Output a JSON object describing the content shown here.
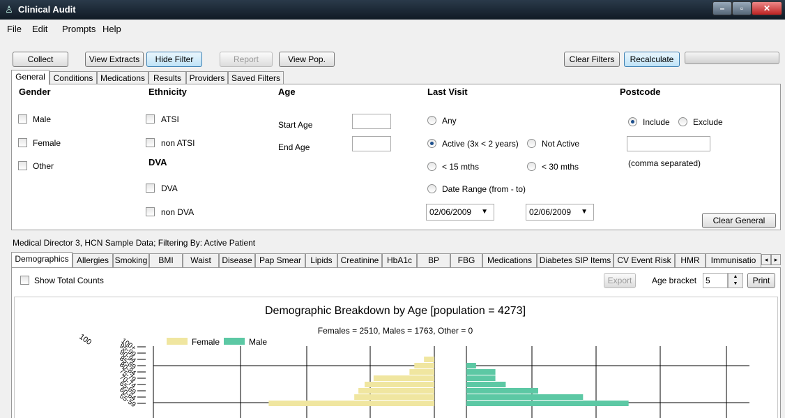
{
  "window": {
    "title": "Clinical Audit"
  },
  "menu": [
    "File",
    "Edit",
    "Prompts",
    "Help"
  ],
  "toolbar": {
    "collect": "Collect",
    "view_extracts": "View Extracts",
    "hide_filter": "Hide Filter",
    "report": "Report",
    "view_pop": "View Pop.",
    "clear_filters": "Clear Filters",
    "recalculate": "Recalculate"
  },
  "filter_tabs": [
    "General",
    "Conditions",
    "Medications",
    "Results",
    "Providers",
    "Saved Filters"
  ],
  "general": {
    "gender": {
      "header": "Gender",
      "options": [
        "Male",
        "Female",
        "Other"
      ]
    },
    "ethnicity": {
      "header": "Ethnicity",
      "options": [
        "ATSI",
        "non ATSI"
      ]
    },
    "dva": {
      "header": "DVA",
      "options": [
        "DVA",
        "non DVA"
      ]
    },
    "age": {
      "header": "Age",
      "start_label": "Start Age",
      "end_label": "End Age",
      "start_value": "",
      "end_value": ""
    },
    "last_visit": {
      "header": "Last Visit",
      "any": "Any",
      "active": "Active (3x < 2 years)",
      "not_active": "Not Active",
      "lt15": "< 15 mths",
      "lt30": "< 30 mths",
      "date_range": "Date Range (from - to)",
      "selected": "active",
      "date_from": "02/06/2009",
      "date_to": "02/06/2009"
    },
    "postcode": {
      "header": "Postcode",
      "include": "Include",
      "exclude": "Exclude",
      "selected": "include",
      "value": "",
      "hint": "(comma separated)"
    },
    "clear_general": "Clear General"
  },
  "status_text": "Medical Director 3, HCN Sample Data; Filtering By: Active Patient",
  "result_tabs": [
    "Demographics",
    "Allergies",
    "Smoking",
    "BMI",
    "Waist",
    "Disease",
    "Pap Smear",
    "Lipids",
    "Creatinine",
    "HbA1c",
    "BP",
    "FBG",
    "Medications",
    "Diabetes SIP Items",
    "CV Event Risk",
    "HMR",
    "Immunisatio"
  ],
  "demographics": {
    "show_total_counts": "Show Total Counts",
    "export": "Export",
    "age_bracket_label": "Age bracket",
    "age_bracket_value": "5",
    "print": "Print"
  },
  "colors": {
    "female": "#f0e6a0",
    "male": "#5cc8a4"
  },
  "chart_data": {
    "type": "bar",
    "orientation": "population-pyramid",
    "title": "Demographic Breakdown by Age [population = 4273]",
    "subtitle": "Females = 2510, Males = 1763, Other = 0",
    "categories": [
      "100+",
      "95-99",
      "90-94",
      "85-89",
      "80-84",
      "75-79",
      "70-74",
      "65-69",
      "60-64",
      "55-59"
    ],
    "axis_top_label": "100",
    "series": [
      {
        "name": "Female",
        "values": [
          0,
          0,
          15,
          29,
          36,
          88,
          101,
          110,
          116,
          240
        ]
      },
      {
        "name": "Male",
        "values": [
          0,
          0,
          0,
          14,
          42,
          42,
          57,
          104,
          169,
          235
        ]
      }
    ],
    "legend": "top-left",
    "grid": true
  }
}
